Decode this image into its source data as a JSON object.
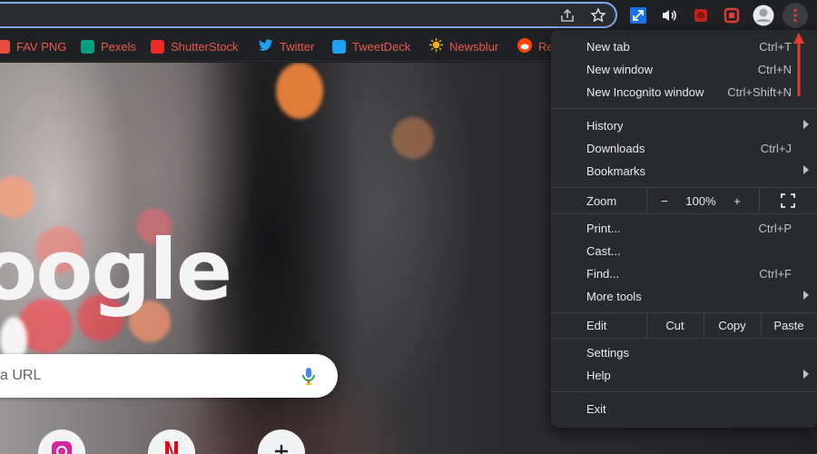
{
  "bookmarks": [
    {
      "label": "FAV PNG",
      "color": "#e84c3d"
    },
    {
      "label": "Pexels",
      "color": "#05a081"
    },
    {
      "label": "ShutterStock",
      "color": "#ee2b24"
    },
    {
      "label": "Twitter",
      "color": "#1da1f2"
    },
    {
      "label": "TweetDeck",
      "color": "#1da1f2"
    },
    {
      "label": "Newsblur",
      "color": "#f7b500"
    },
    {
      "label": "Re",
      "color": "#ff4500"
    }
  ],
  "search": {
    "placeholder": "a URL"
  },
  "menu": {
    "new_tab": {
      "label": "New tab",
      "shortcut": "Ctrl+T"
    },
    "new_window": {
      "label": "New window",
      "shortcut": "Ctrl+N"
    },
    "incognito": {
      "label": "New Incognito window",
      "shortcut": "Ctrl+Shift+N"
    },
    "history": {
      "label": "History"
    },
    "downloads": {
      "label": "Downloads",
      "shortcut": "Ctrl+J"
    },
    "bookmarks": {
      "label": "Bookmarks"
    },
    "zoom": {
      "label": "Zoom",
      "minus": "−",
      "value": "100%",
      "plus": "+"
    },
    "print": {
      "label": "Print...",
      "shortcut": "Ctrl+P"
    },
    "cast": {
      "label": "Cast..."
    },
    "find": {
      "label": "Find...",
      "shortcut": "Ctrl+F"
    },
    "more_tools": {
      "label": "More tools"
    },
    "edit": {
      "label": "Edit",
      "cut": "Cut",
      "copy": "Copy",
      "paste": "Paste"
    },
    "settings": {
      "label": "Settings"
    },
    "help": {
      "label": "Help"
    },
    "exit": {
      "label": "Exit"
    }
  },
  "icons": {
    "share": "share-icon",
    "star": "star-icon",
    "kebab": "three-dot-menu-icon",
    "mic": "microphone-icon",
    "fullscreen": "fullscreen-icon"
  },
  "colors": {
    "accent_arrow": "#e53935",
    "menu_bg": "#292a2d",
    "bookmark_text": "#e8594e"
  }
}
